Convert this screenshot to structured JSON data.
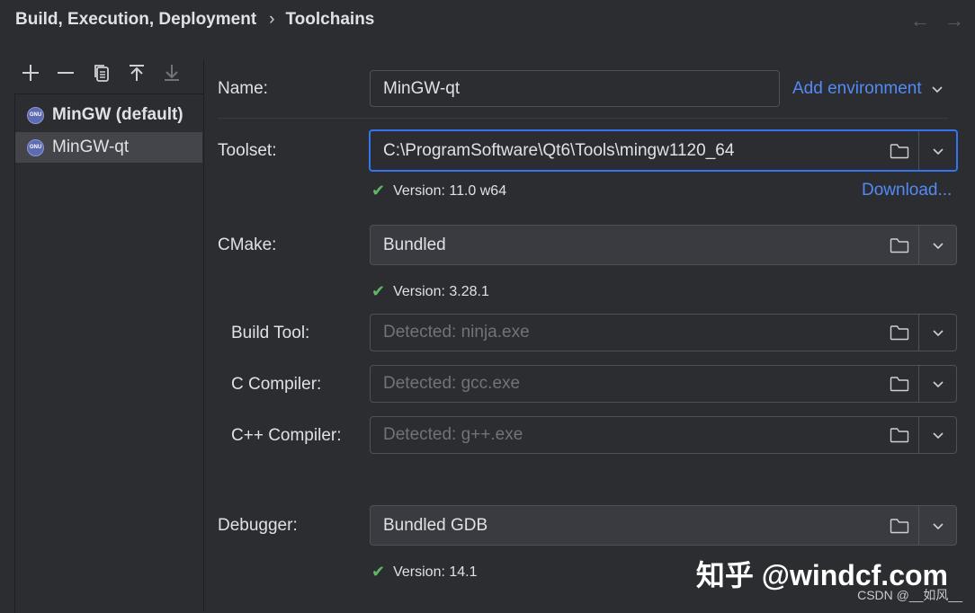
{
  "header": {
    "breadcrumb_parent": "Build, Execution, Deployment",
    "separator": "›",
    "breadcrumb_current": "Toolchains",
    "back_icon": "←",
    "forward_icon": "→"
  },
  "toolbar": {
    "add": "+",
    "remove": "—",
    "copy": "⧉",
    "move_up": "↥",
    "move_down": "↧"
  },
  "toolchains": [
    {
      "name": "MinGW (default)",
      "badge": "GNU"
    },
    {
      "name": "MinGW-qt",
      "badge": "GNU"
    }
  ],
  "form": {
    "name_label": "Name:",
    "name_value": "MinGW-qt",
    "add_environment": "Add environment",
    "toolset_label": "Toolset:",
    "toolset_value": "C:\\ProgramSoftware\\Qt6\\Tools\\mingw1120_64",
    "toolset_version": "Version: 11.0 w64",
    "download_link": "Download...",
    "cmake_label": "CMake:",
    "cmake_value": "Bundled",
    "cmake_version": "Version: 3.28.1",
    "build_tool_label": "Build Tool:",
    "build_tool_placeholder": "Detected: ninja.exe",
    "c_compiler_label": "C Compiler:",
    "c_compiler_placeholder": "Detected: gcc.exe",
    "cpp_compiler_label": "C++ Compiler:",
    "cpp_compiler_placeholder": "Detected: g++.exe",
    "debugger_label": "Debugger:",
    "debugger_value": "Bundled GDB",
    "debugger_version": "Version: 14.1"
  },
  "watermark": {
    "zhihu": "知乎 @windcf.com",
    "csdn": "CSDN @__如风__"
  },
  "colors": {
    "accent": "#3574f0",
    "link": "#548af7",
    "check": "#5fb865",
    "background": "#2b2d30"
  }
}
